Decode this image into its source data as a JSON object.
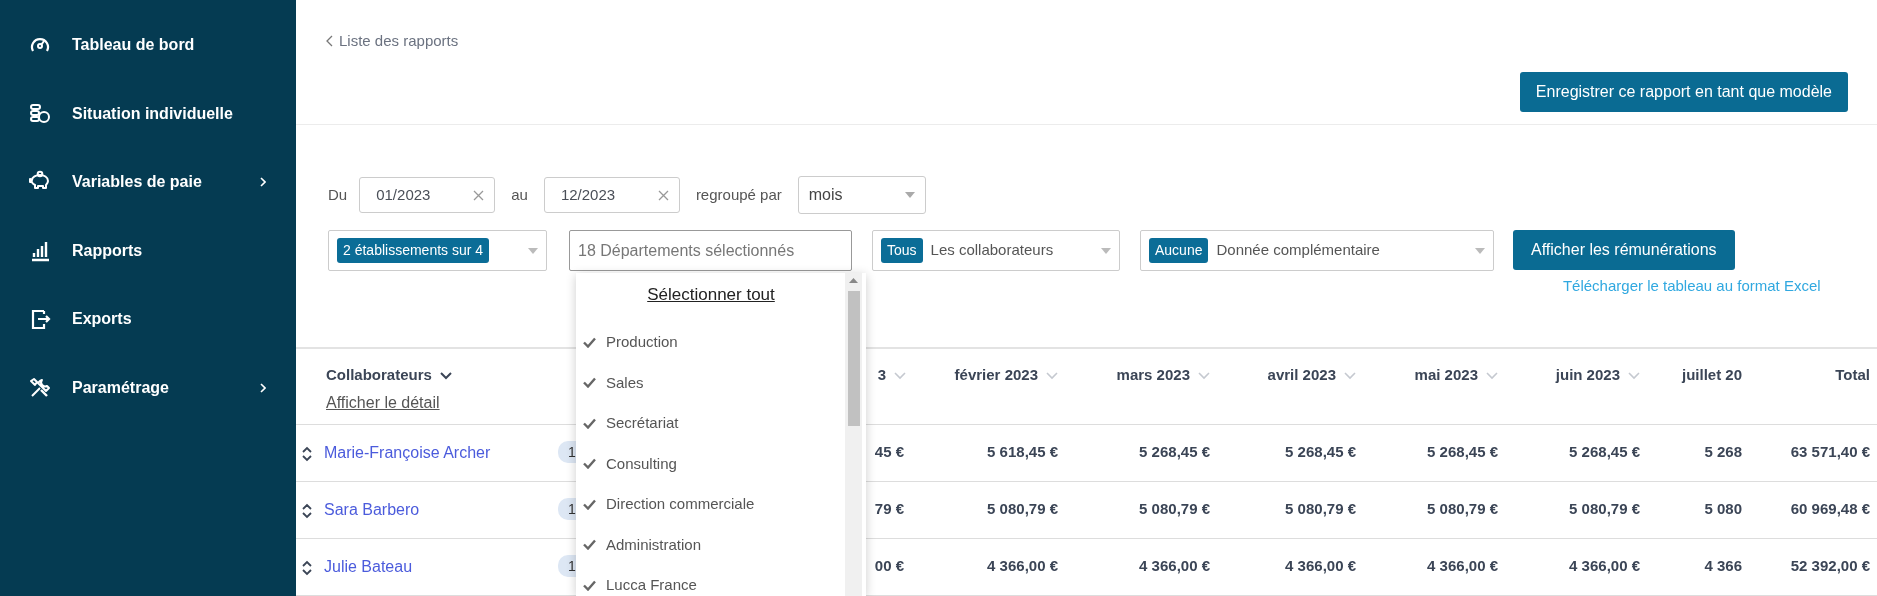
{
  "sidebar": {
    "items": [
      {
        "label": "Tableau de bord",
        "has_submenu": false
      },
      {
        "label": "Situation individuelle",
        "has_submenu": false
      },
      {
        "label": "Variables de paie",
        "has_submenu": true
      },
      {
        "label": "Rapports",
        "has_submenu": false
      },
      {
        "label": "Exports",
        "has_submenu": false
      },
      {
        "label": "Paramétrage",
        "has_submenu": true
      }
    ]
  },
  "back_link": "Liste des rapports",
  "save_template_button": "Enregistrer ce rapport en tant que modèle",
  "filters": {
    "from_label": "Du",
    "from_value": "01/2023",
    "to_label": "au",
    "to_value": "12/2023",
    "group_label": "regroupé par",
    "group_value": "mois",
    "establishments": {
      "badge": "2 établissements sur 4"
    },
    "departments": {
      "placeholder": "18 Départements sélectionnés",
      "focused": true
    },
    "employees": {
      "badge": "Tous",
      "label": "Les collaborateurs"
    },
    "extra": {
      "badge": "Aucune",
      "label": "Donnée complémentaire"
    },
    "submit_button": "Afficher les rémunérations",
    "excel_link": "Télécharger le tableau au format Excel"
  },
  "departments_dropdown": {
    "select_all": "Sélectionner tout",
    "items": [
      {
        "label": "Production",
        "checked": true
      },
      {
        "label": "Sales",
        "checked": true
      },
      {
        "label": "Secrétariat",
        "checked": true
      },
      {
        "label": "Consulting",
        "checked": true
      },
      {
        "label": "Direction commerciale",
        "checked": true
      },
      {
        "label": "Administration",
        "checked": true
      },
      {
        "label": "Lucca France",
        "checked": true
      }
    ]
  },
  "table": {
    "name_header": "Collaborateurs",
    "detail_link": "Afficher le détail",
    "columns": [
      {
        "label": "3",
        "sortable": true
      },
      {
        "label": "février 2023",
        "sortable": true
      },
      {
        "label": "mars 2023",
        "sortable": true
      },
      {
        "label": "avril 2023",
        "sortable": true
      },
      {
        "label": "mai 2023",
        "sortable": true
      },
      {
        "label": "juin 2023",
        "sortable": true
      },
      {
        "label": "juillet 20",
        "sortable": false
      },
      {
        "label": "Total",
        "sortable": false
      }
    ],
    "rows": [
      {
        "name": "Marie-Françoise Archer",
        "badge": "1",
        "values": [
          "45 €",
          "5 618,45 €",
          "5 268,45 €",
          "5 268,45 €",
          "5 268,45 €",
          "5 268,45 €",
          "5 268",
          "63 571,40 €"
        ]
      },
      {
        "name": "Sara Barbero",
        "badge": "1",
        "values": [
          "79 €",
          "5 080,79 €",
          "5 080,79 €",
          "5 080,79 €",
          "5 080,79 €",
          "5 080,79 €",
          "5 080",
          "60 969,48 €"
        ]
      },
      {
        "name": "Julie Bateau",
        "badge": "1",
        "values": [
          "00 €",
          "4 366,00 €",
          "4 366,00 €",
          "4 366,00 €",
          "4 366,00 €",
          "4 366,00 €",
          "4 366",
          "52 392,00 €"
        ]
      }
    ]
  }
}
